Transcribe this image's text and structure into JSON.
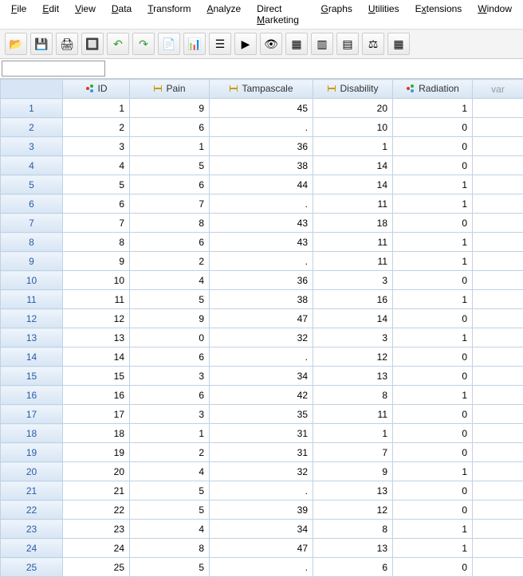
{
  "menu": {
    "file": "File",
    "edit": "Edit",
    "view": "View",
    "data": "Data",
    "transform": "Transform",
    "analyze": "Analyze",
    "directmarketing": "Direct Marketing",
    "graphs": "Graphs",
    "utilities": "Utilities",
    "extensions": "Extensions",
    "window": "Window"
  },
  "toolbar_icons": {
    "open": "open-icon",
    "save": "save-icon",
    "print": "print-icon",
    "recall": "dialog-recall-icon",
    "undo": "undo-icon",
    "redo": "redo-icon",
    "gotocase": "goto-case-icon",
    "gotovar": "goto-variable-icon",
    "variables": "variables-icon",
    "run": "run-icon",
    "find": "find-icon",
    "insertcase": "insert-cases-icon",
    "insertvar": "insert-variable-icon",
    "splitfile": "split-file-icon",
    "weight": "weight-cases-icon",
    "valuelabels": "value-labels-icon"
  },
  "formula_value": "",
  "columns": [
    {
      "key": "ID",
      "label": "ID",
      "type": "nominal"
    },
    {
      "key": "Pain",
      "label": "Pain",
      "type": "scale"
    },
    {
      "key": "Tampascale",
      "label": "Tampascale",
      "type": "scale"
    },
    {
      "key": "Disability",
      "label": "Disability",
      "type": "scale"
    },
    {
      "key": "Radiation",
      "label": "Radiation",
      "type": "nominal"
    }
  ],
  "var_label": "var",
  "rows": [
    {
      "n": 1,
      "ID": 1,
      "Pain": 9,
      "Tampascale": 45,
      "Disability": 20,
      "Radiation": 1
    },
    {
      "n": 2,
      "ID": 2,
      "Pain": 6,
      "Tampascale": ".",
      "Disability": 10,
      "Radiation": 0
    },
    {
      "n": 3,
      "ID": 3,
      "Pain": 1,
      "Tampascale": 36,
      "Disability": 1,
      "Radiation": 0
    },
    {
      "n": 4,
      "ID": 4,
      "Pain": 5,
      "Tampascale": 38,
      "Disability": 14,
      "Radiation": 0
    },
    {
      "n": 5,
      "ID": 5,
      "Pain": 6,
      "Tampascale": 44,
      "Disability": 14,
      "Radiation": 1
    },
    {
      "n": 6,
      "ID": 6,
      "Pain": 7,
      "Tampascale": ".",
      "Disability": 11,
      "Radiation": 1
    },
    {
      "n": 7,
      "ID": 7,
      "Pain": 8,
      "Tampascale": 43,
      "Disability": 18,
      "Radiation": 0
    },
    {
      "n": 8,
      "ID": 8,
      "Pain": 6,
      "Tampascale": 43,
      "Disability": 11,
      "Radiation": 1
    },
    {
      "n": 9,
      "ID": 9,
      "Pain": 2,
      "Tampascale": ".",
      "Disability": 11,
      "Radiation": 1
    },
    {
      "n": 10,
      "ID": 10,
      "Pain": 4,
      "Tampascale": 36,
      "Disability": 3,
      "Radiation": 0
    },
    {
      "n": 11,
      "ID": 11,
      "Pain": 5,
      "Tampascale": 38,
      "Disability": 16,
      "Radiation": 1
    },
    {
      "n": 12,
      "ID": 12,
      "Pain": 9,
      "Tampascale": 47,
      "Disability": 14,
      "Radiation": 0
    },
    {
      "n": 13,
      "ID": 13,
      "Pain": 0,
      "Tampascale": 32,
      "Disability": 3,
      "Radiation": 1
    },
    {
      "n": 14,
      "ID": 14,
      "Pain": 6,
      "Tampascale": ".",
      "Disability": 12,
      "Radiation": 0
    },
    {
      "n": 15,
      "ID": 15,
      "Pain": 3,
      "Tampascale": 34,
      "Disability": 13,
      "Radiation": 0
    },
    {
      "n": 16,
      "ID": 16,
      "Pain": 6,
      "Tampascale": 42,
      "Disability": 8,
      "Radiation": 1
    },
    {
      "n": 17,
      "ID": 17,
      "Pain": 3,
      "Tampascale": 35,
      "Disability": 11,
      "Radiation": 0
    },
    {
      "n": 18,
      "ID": 18,
      "Pain": 1,
      "Tampascale": 31,
      "Disability": 1,
      "Radiation": 0
    },
    {
      "n": 19,
      "ID": 19,
      "Pain": 2,
      "Tampascale": 31,
      "Disability": 7,
      "Radiation": 0
    },
    {
      "n": 20,
      "ID": 20,
      "Pain": 4,
      "Tampascale": 32,
      "Disability": 9,
      "Radiation": 1
    },
    {
      "n": 21,
      "ID": 21,
      "Pain": 5,
      "Tampascale": ".",
      "Disability": 13,
      "Radiation": 0
    },
    {
      "n": 22,
      "ID": 22,
      "Pain": 5,
      "Tampascale": 39,
      "Disability": 12,
      "Radiation": 0
    },
    {
      "n": 23,
      "ID": 23,
      "Pain": 4,
      "Tampascale": 34,
      "Disability": 8,
      "Radiation": 1
    },
    {
      "n": 24,
      "ID": 24,
      "Pain": 8,
      "Tampascale": 47,
      "Disability": 13,
      "Radiation": 1
    },
    {
      "n": 25,
      "ID": 25,
      "Pain": 5,
      "Tampascale": ".",
      "Disability": 6,
      "Radiation": 0
    }
  ]
}
